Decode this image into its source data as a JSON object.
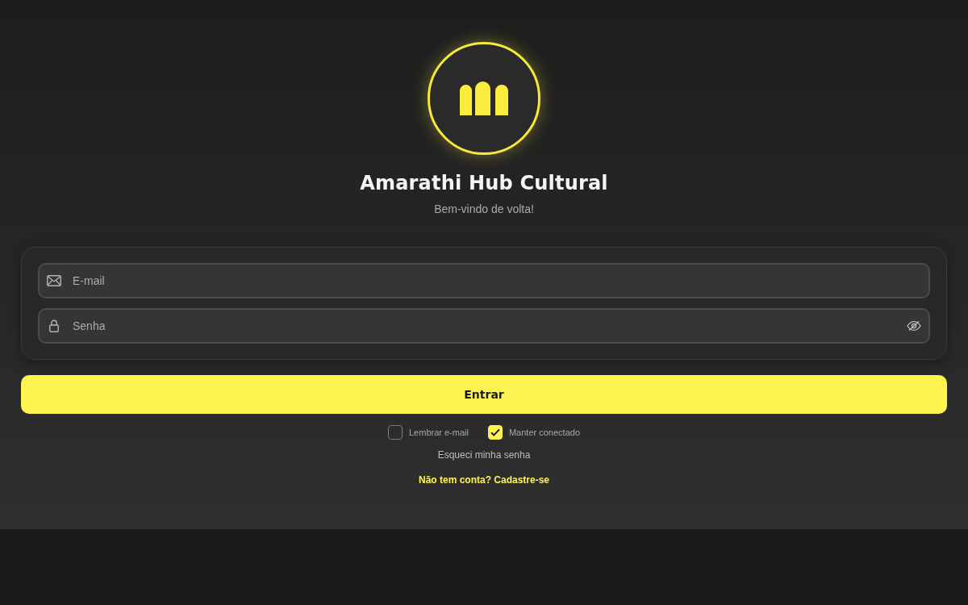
{
  "header": {
    "title": "Amarathi Hub Cultural",
    "subtitle": "Bem-vindo de volta!"
  },
  "form": {
    "fields": [
      {
        "kind": "email",
        "placeholder": "E-mail"
      },
      {
        "kind": "password",
        "placeholder": "Senha"
      }
    ]
  },
  "submit_button": "Entrar",
  "options": [
    {
      "label": "Lembrar e-mail",
      "checked": false
    },
    {
      "label": "Manter conectado",
      "checked": true
    }
  ],
  "links": [
    {
      "kind": "secondary",
      "label": "Esqueci minha senha"
    },
    {
      "kind": "accent",
      "label": "Não tem conta? Cadastre-se"
    }
  ]
}
